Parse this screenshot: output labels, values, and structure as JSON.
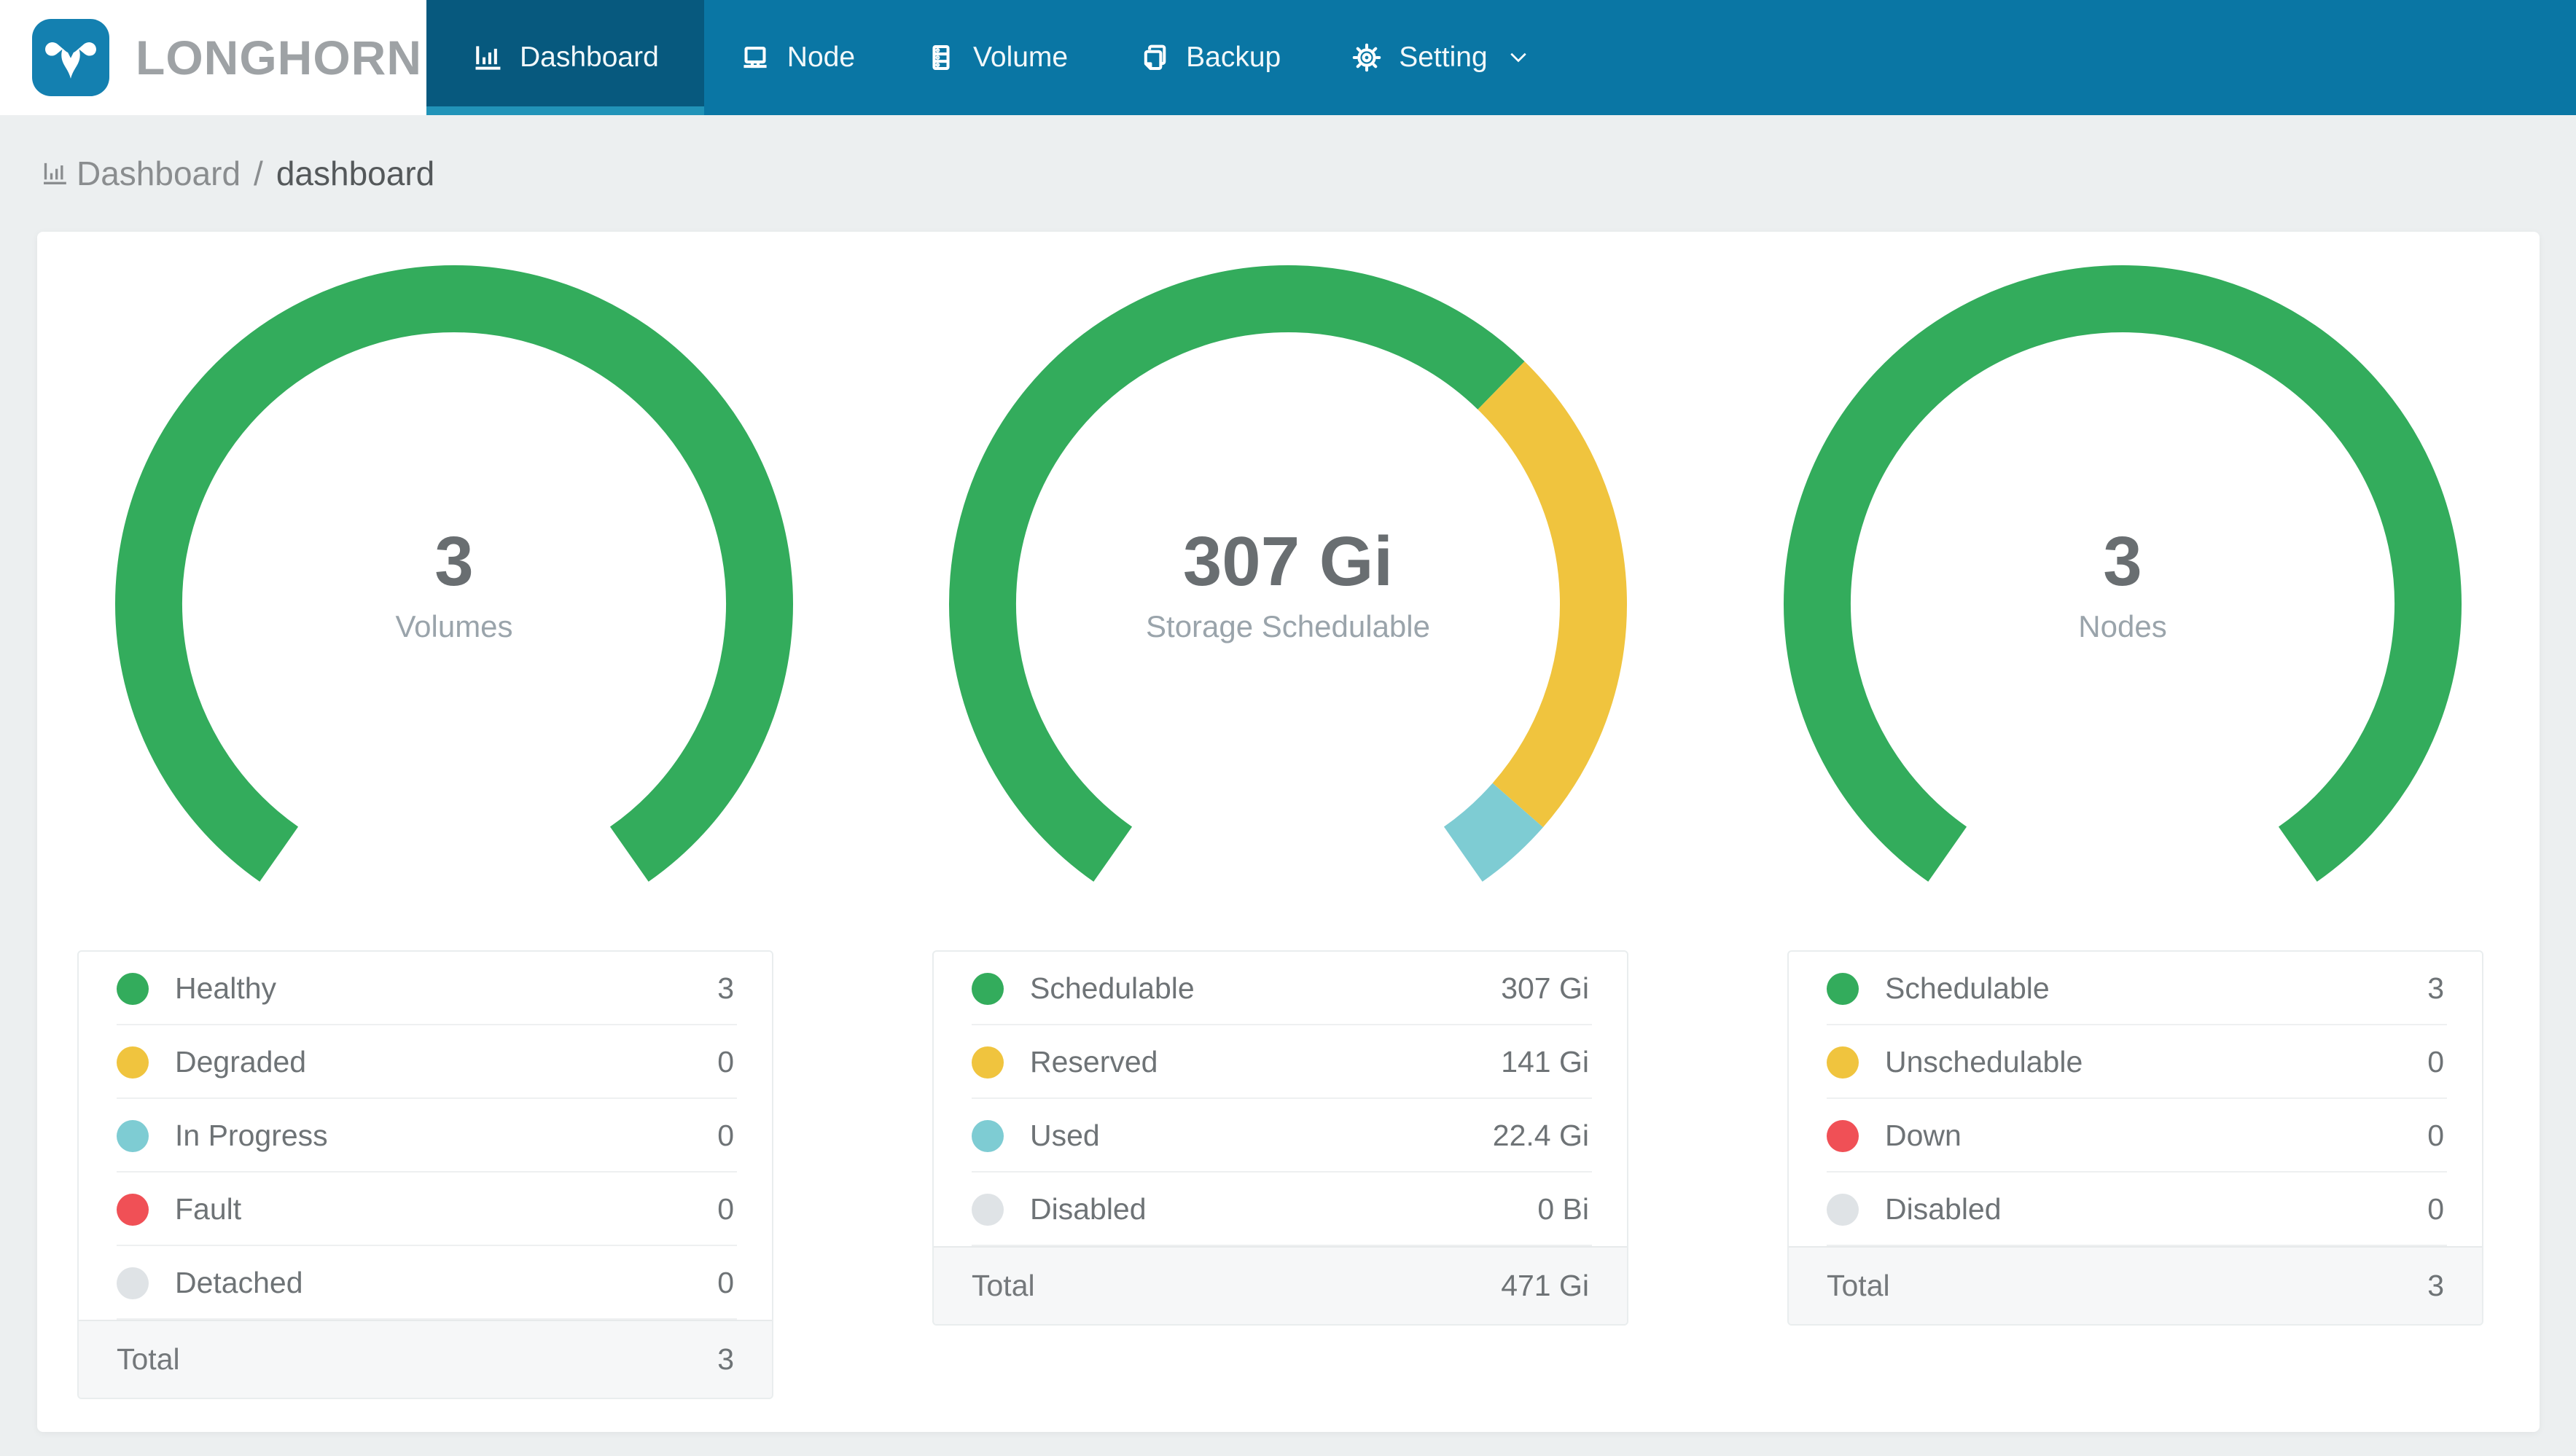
{
  "brand": {
    "name": "LONGHORN"
  },
  "nav": {
    "items": [
      {
        "label": "Dashboard",
        "icon": "bar-chart-icon",
        "active": true
      },
      {
        "label": "Node",
        "icon": "laptop-icon",
        "active": false
      },
      {
        "label": "Volume",
        "icon": "server-icon",
        "active": false
      },
      {
        "label": "Backup",
        "icon": "copy-icon",
        "active": false
      },
      {
        "label": "Setting",
        "icon": "gear-icon",
        "active": false,
        "has_dropdown": true
      }
    ]
  },
  "breadcrumb": {
    "icon": "bar-chart-icon",
    "section": "Dashboard",
    "separator": "/",
    "page": "dashboard"
  },
  "colors": {
    "navbar": "#0A76A4",
    "navbar_active": "#07597E",
    "navbar_active_underline": "#2193B8",
    "logo_tile": "#1480B0",
    "brand_text": "#9EA2A5",
    "page_bg": "#ECEFF0",
    "status_green": "#33AC5C",
    "status_yellow": "#F0C43E",
    "status_teal": "#7ECCD3",
    "status_red": "#F05056",
    "status_gray": "#DFE3E6"
  },
  "chart_data": [
    {
      "type": "donut-gauge",
      "arc_degrees": 290,
      "gap_position": "bottom",
      "center_value": "3",
      "center_label": "Volumes",
      "segments": [
        {
          "label": "Healthy",
          "value": 3,
          "display": "3",
          "color": "#33AC5C"
        },
        {
          "label": "Degraded",
          "value": 0,
          "display": "0",
          "color": "#F0C43E"
        },
        {
          "label": "In Progress",
          "value": 0,
          "display": "0",
          "color": "#7ECCD3"
        },
        {
          "label": "Fault",
          "value": 0,
          "display": "0",
          "color": "#F05056"
        },
        {
          "label": "Detached",
          "value": 0,
          "display": "0",
          "color": "#DFE3E6"
        }
      ],
      "total": {
        "label": "Total",
        "display": "3"
      }
    },
    {
      "type": "donut-gauge",
      "arc_degrees": 290,
      "gap_position": "bottom",
      "center_value": "307 Gi",
      "center_label": "Storage Schedulable",
      "segments": [
        {
          "label": "Schedulable",
          "value": 307,
          "display": "307 Gi",
          "color": "#33AC5C"
        },
        {
          "label": "Reserved",
          "value": 141,
          "display": "141 Gi",
          "color": "#F0C43E"
        },
        {
          "label": "Used",
          "value": 22.4,
          "display": "22.4 Gi",
          "color": "#7ECCD3"
        },
        {
          "label": "Disabled",
          "value": 0,
          "display": "0 Bi",
          "color": "#DFE3E6"
        }
      ],
      "total": {
        "label": "Total",
        "display": "471 Gi"
      }
    },
    {
      "type": "donut-gauge",
      "arc_degrees": 290,
      "gap_position": "bottom",
      "center_value": "3",
      "center_label": "Nodes",
      "segments": [
        {
          "label": "Schedulable",
          "value": 3,
          "display": "3",
          "color": "#33AC5C"
        },
        {
          "label": "Unschedulable",
          "value": 0,
          "display": "0",
          "color": "#F0C43E"
        },
        {
          "label": "Down",
          "value": 0,
          "display": "0",
          "color": "#F05056"
        },
        {
          "label": "Disabled",
          "value": 0,
          "display": "0",
          "color": "#DFE3E6"
        }
      ],
      "total": {
        "label": "Total",
        "display": "3"
      }
    }
  ]
}
